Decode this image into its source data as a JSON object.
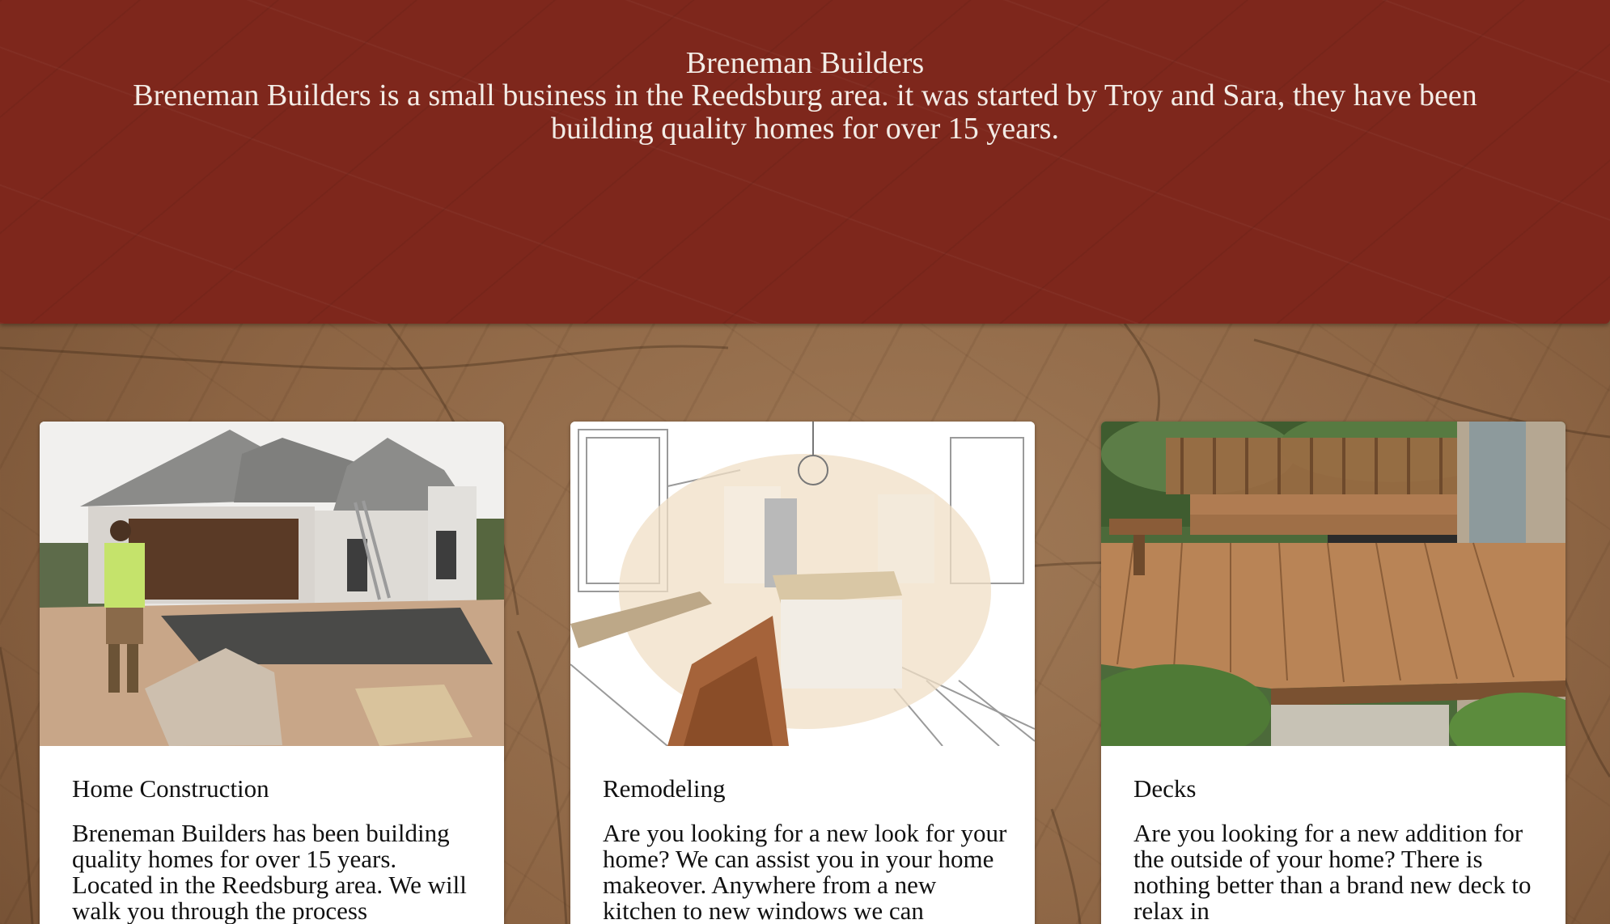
{
  "header": {
    "title": "Breneman Builders",
    "description": "Breneman Builders is a small business in the Reedsburg area. it was started by Troy and Sara, they have been building quality homes for over 15 years."
  },
  "cards": [
    {
      "title": "Home Construction",
      "text": "Breneman Builders has been building quality homes for over 15 years. Located in the Reedsburg area. We will walk you through the process"
    },
    {
      "title": "Remodeling",
      "text": "Are you looking for a new look for your home? We can assist you in your home makeover. Anywhere from a new kitchen to new windows we can"
    },
    {
      "title": "Decks",
      "text": "Are you looking for a new addition for the outside of your home? There is nothing better than a brand new deck to relax in"
    }
  ],
  "colors": {
    "header_bg": "#7e271c",
    "header_text": "#f3ece6",
    "card_bg": "#ffffff",
    "wood_bg": "#8c6443"
  }
}
